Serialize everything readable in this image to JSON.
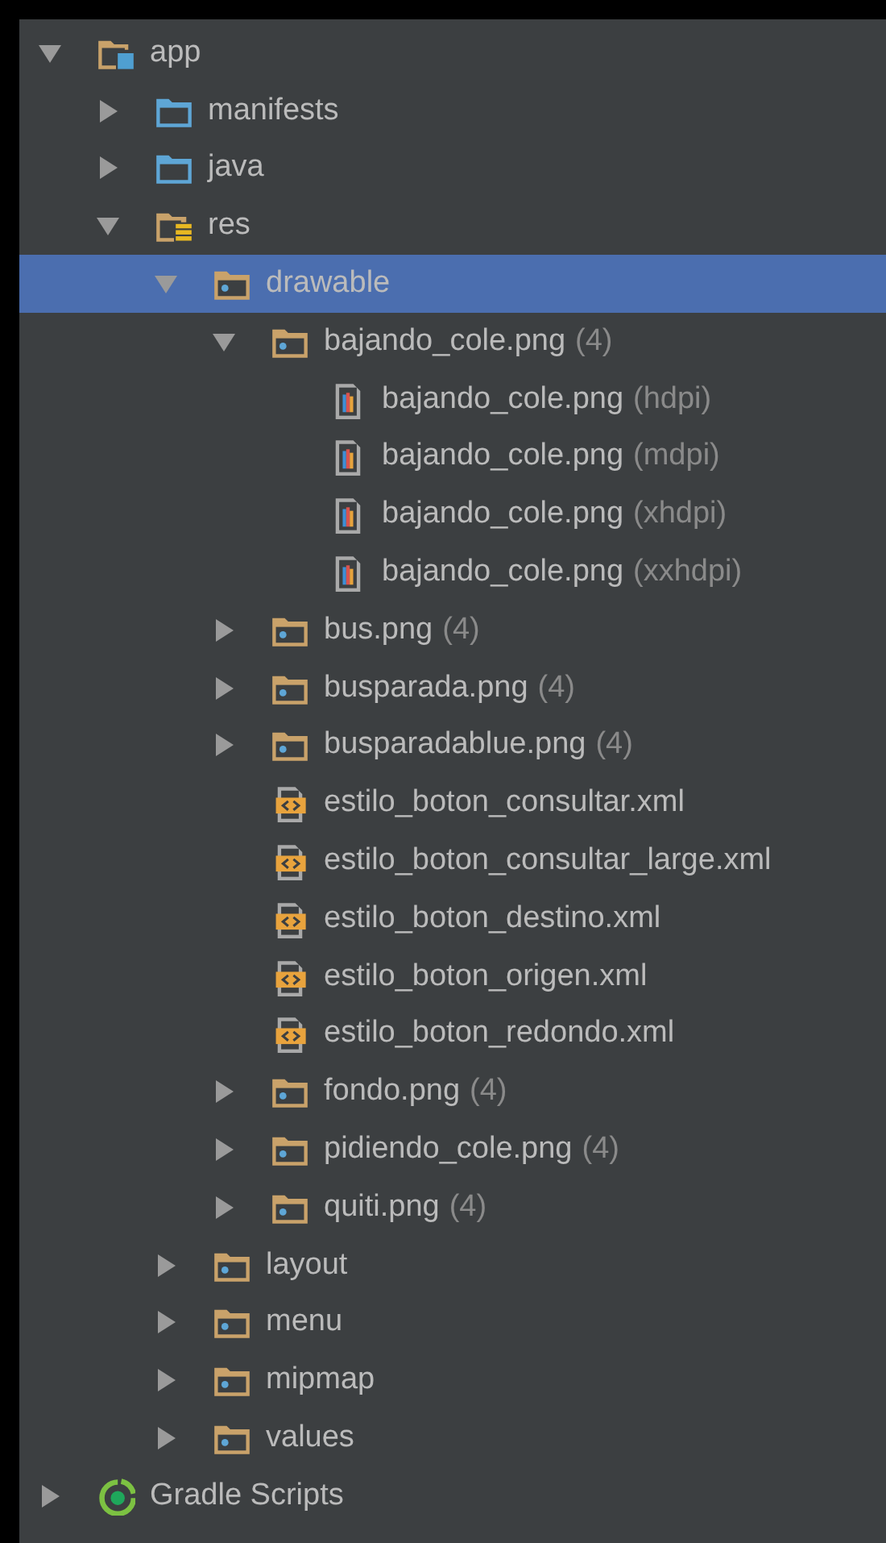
{
  "project_tree": [
    {
      "name": "app",
      "kind": "module",
      "expanded": true,
      "selected": false,
      "children": [
        {
          "name": "manifests",
          "kind": "source-folder",
          "expanded": false,
          "selected": false
        },
        {
          "name": "java",
          "kind": "source-folder",
          "expanded": false,
          "selected": false
        },
        {
          "name": "res",
          "kind": "res-folder",
          "expanded": true,
          "selected": false,
          "children": [
            {
              "name": "drawable",
              "kind": "folder",
              "expanded": true,
              "selected": true,
              "children": [
                {
                  "name": "bajando_cole.png",
                  "detail": "(4)",
                  "kind": "folder",
                  "expanded": true,
                  "selected": false,
                  "children": [
                    {
                      "name": "bajando_cole.png",
                      "detail": "(hdpi)",
                      "kind": "image-file",
                      "selected": false
                    },
                    {
                      "name": "bajando_cole.png",
                      "detail": "(mdpi)",
                      "kind": "image-file",
                      "selected": false
                    },
                    {
                      "name": "bajando_cole.png",
                      "detail": "(xhdpi)",
                      "kind": "image-file",
                      "selected": false
                    },
                    {
                      "name": "bajando_cole.png",
                      "detail": "(xxhdpi)",
                      "kind": "image-file",
                      "selected": false
                    }
                  ]
                },
                {
                  "name": "bus.png",
                  "detail": "(4)",
                  "kind": "folder",
                  "expanded": false,
                  "selected": false
                },
                {
                  "name": "busparada.png",
                  "detail": "(4)",
                  "kind": "folder",
                  "expanded": false,
                  "selected": false
                },
                {
                  "name": "busparadablue.png",
                  "detail": "(4)",
                  "kind": "folder",
                  "expanded": false,
                  "selected": false
                },
                {
                  "name": "estilo_boton_consultar.xml",
                  "kind": "xml-file",
                  "selected": false
                },
                {
                  "name": "estilo_boton_consultar_large.xml",
                  "kind": "xml-file",
                  "selected": false
                },
                {
                  "name": "estilo_boton_destino.xml",
                  "kind": "xml-file",
                  "selected": false
                },
                {
                  "name": "estilo_boton_origen.xml",
                  "kind": "xml-file",
                  "selected": false
                },
                {
                  "name": "estilo_boton_redondo.xml",
                  "kind": "xml-file",
                  "selected": false
                },
                {
                  "name": "fondo.png",
                  "detail": "(4)",
                  "kind": "folder",
                  "expanded": false,
                  "selected": false
                },
                {
                  "name": "pidiendo_cole.png",
                  "detail": "(4)",
                  "kind": "folder",
                  "expanded": false,
                  "selected": false
                },
                {
                  "name": "quiti.png",
                  "detail": "(4)",
                  "kind": "folder",
                  "expanded": false,
                  "selected": false
                }
              ]
            },
            {
              "name": "layout",
              "kind": "folder",
              "expanded": false,
              "selected": false
            },
            {
              "name": "menu",
              "kind": "folder",
              "expanded": false,
              "selected": false
            },
            {
              "name": "mipmap",
              "kind": "folder",
              "expanded": false,
              "selected": false
            },
            {
              "name": "values",
              "kind": "folder",
              "expanded": false,
              "selected": false
            }
          ]
        }
      ]
    },
    {
      "name": "Gradle Scripts",
      "kind": "gradle",
      "expanded": false,
      "selected": false
    }
  ]
}
